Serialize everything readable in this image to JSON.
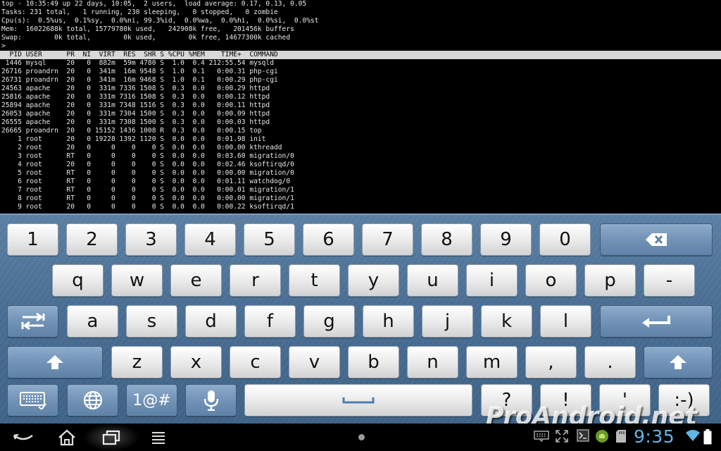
{
  "terminal": {
    "summary": [
      "top - 10:35:49 up 22 days, 10:05,  2 users,  load average: 0.17, 0.13, 0.05",
      "Tasks: 231 total,   1 running, 230 sleeping,   0 stopped,   0 zombie",
      "Cpu(s):  0.5%us,  0.1%sy,  0.0%ni, 99.3%id,  0.0%wa,  0.0%hi,  0.0%si,  0.0%st",
      "Mem:  16022688k total, 15779780k used,   242908k free,   201456k buffers",
      "Swap:        0k total,        0k used,        0k free, 14677300k cached"
    ],
    "prompt": ">",
    "header": "  PID USER      PR  NI  VIRT  RES  SHR S %CPU %MEM    TIME+  COMMAND",
    "processes": [
      " 1446 mysql     20   0  882m  59m 4780 S  1.0  0.4 212:55.54 mysqld",
      "26716 proandrn  20   0  341m  16m 9548 S  1.0  0.1   0:00.31 php-cgi",
      "26731 proandrn  20   0  341m  16m 9468 S  1.0  0.1   0:00.29 php-cgi",
      "24563 apache    20   0  331m 7336 1508 S  0.3  0.0   0:00.29 httpd",
      "25816 apache    20   0  331m 7316 1508 S  0.3  0.0   0:00.12 httpd",
      "25894 apache    20   0  331m 7348 1516 S  0.3  0.0   0:00.11 httpd",
      "26053 apache    20   0  331m 7304 1500 S  0.3  0.0   0:00.09 httpd",
      "26555 apache    20   0  331m 7308 1500 S  0.3  0.0   0:00.03 httpd",
      "26665 proandrn  20   0 15152 1436 1008 R  0.3  0.0   0:00.15 top",
      "    1 root      20   0 19228 1392 1120 S  0.0  0.0   0:01.98 init",
      "    2 root      20   0     0    0    0 S  0.0  0.0   0:00.00 kthreadd",
      "    3 root      RT   0     0    0    0 S  0.0  0.0   0:03.60 migration/0",
      "    4 root      20   0     0    0    0 S  0.0  0.0   0:02.46 ksoftirqd/0",
      "    5 root      RT   0     0    0    0 S  0.0  0.0   0:00.00 migration/0",
      "    6 root      RT   0     0    0    0 S  0.0  0.0   0:01.11 watchdog/0",
      "    7 root      RT   0     0    0    0 S  0.0  0.0   0:00.01 migration/1",
      "    8 root      RT   0     0    0    0 S  0.0  0.0   0:00.00 migration/1",
      "    9 root      20   0     0    0    0 S  0.0  0.0   0:00.22 ksoftirqd/1"
    ]
  },
  "keyboard": {
    "row_numbers": [
      "1",
      "2",
      "3",
      "4",
      "5",
      "6",
      "7",
      "8",
      "9",
      "0"
    ],
    "row_top": [
      "q",
      "w",
      "e",
      "r",
      "t",
      "y",
      "u",
      "i",
      "o",
      "p",
      "-"
    ],
    "row_home": [
      "a",
      "s",
      "d",
      "f",
      "g",
      "h",
      "j",
      "k",
      "l"
    ],
    "row_bottom": [
      "z",
      "x",
      "c",
      "v",
      "b",
      "n",
      "m",
      ",",
      "."
    ],
    "symbols_label": "1@#",
    "space_label": "",
    "punct": [
      "?",
      "!",
      "'",
      ":-)"
    ],
    "icons": {
      "backspace": "backspace-icon",
      "tab": "tab-icon",
      "enter": "enter-icon",
      "shift": "shift-icon",
      "keyboard_settings": "keyboard-settings-icon",
      "language": "globe-icon",
      "voice": "microphone-icon"
    },
    "colors": {
      "background": "#4a6e93",
      "light_key": "#e9e9e9",
      "dark_key": "#6f91b5"
    }
  },
  "system_bar": {
    "clock": "9:35",
    "clock_color": "#5fb7e6",
    "nav_icons": [
      "back-icon",
      "home-icon",
      "recent-apps-icon",
      "menu-icon"
    ],
    "tray_icons": [
      "keyboard-icon",
      "fullscreen-icon",
      "terminal-icon",
      "android-icon",
      "sd-card-icon",
      "wifi-icon",
      "battery-icon"
    ]
  },
  "watermark": "ProAndroid.net"
}
